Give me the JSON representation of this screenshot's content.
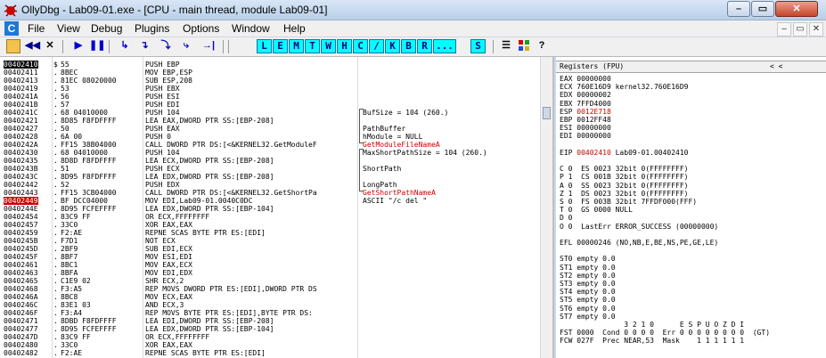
{
  "window": {
    "title": "OllyDbg - Lab09-01.exe - [CPU - main thread, module Lab09-01]",
    "min": "–",
    "max": "▭",
    "close": "✕"
  },
  "menu": {
    "icon": "C",
    "items": [
      "File",
      "View",
      "Debug",
      "Plugins",
      "Options",
      "Window",
      "Help"
    ],
    "mdi": [
      "–",
      "▭",
      "✕"
    ]
  },
  "toolbar": {
    "buttons": [
      {
        "name": "open-icon",
        "glyph": "📂"
      },
      {
        "name": "restart-icon",
        "glyph": "◀◀"
      },
      {
        "name": "close-program-icon",
        "glyph": "✕"
      },
      {
        "name": "run-icon",
        "glyph": "▶"
      },
      {
        "name": "pause-icon",
        "glyph": "❚❚"
      },
      {
        "name": "step-into-icon",
        "glyph": "↳"
      },
      {
        "name": "step-over-icon",
        "glyph": "↴"
      },
      {
        "name": "trace-into-icon",
        "glyph": "⤵"
      },
      {
        "name": "trace-over-icon",
        "glyph": "⤷"
      },
      {
        "name": "execute-till-return-icon",
        "glyph": "→|"
      }
    ],
    "letters": [
      "L",
      "E",
      "M",
      "T",
      "W",
      "H",
      "C",
      "/",
      "K",
      "B",
      "R",
      "...",
      "S"
    ]
  },
  "disasm": [
    {
      "addr": "00402410",
      "mark": "$",
      "hex": "55",
      "ins": "PUSH EBP",
      "cmt": "",
      "state": "sel"
    },
    {
      "addr": "00402411",
      "mark": ".",
      "hex": "8BEC",
      "ins": "MOV EBP,ESP",
      "cmt": ""
    },
    {
      "addr": "00402413",
      "mark": ".",
      "hex": "81EC 08020000",
      "ins": "SUB ESP,208",
      "cmt": ""
    },
    {
      "addr": "00402419",
      "mark": ".",
      "hex": "53",
      "ins": "PUSH EBX",
      "cmt": ""
    },
    {
      "addr": "0040241A",
      "mark": ".",
      "hex": "56",
      "ins": "PUSH ESI",
      "cmt": ""
    },
    {
      "addr": "0040241B",
      "mark": ".",
      "hex": "57",
      "ins": "PUSH EDI",
      "cmt": ""
    },
    {
      "addr": "0040241C",
      "mark": ".",
      "hex": "68 04010000",
      "ins": "PUSH 104",
      "cmt": "BufSize = 104 (260.)"
    },
    {
      "addr": "00402421",
      "mark": ".",
      "hex": "8D85 F8FDFFFF",
      "ins": "LEA EAX,DWORD PTR SS:[EBP-208]",
      "cmt": ""
    },
    {
      "addr": "00402427",
      "mark": ".",
      "hex": "50",
      "ins": "PUSH EAX",
      "cmt": "PathBuffer"
    },
    {
      "addr": "00402428",
      "mark": ".",
      "hex": "6A 00",
      "ins": "PUSH 0",
      "cmt": "hModule = NULL"
    },
    {
      "addr": "0040242A",
      "mark": ".",
      "hex": "FF15 38B04000",
      "ins": "CALL DWORD PTR DS:[<&KERNEL32.GetModuleF",
      "cmt": "GetModuleFileNameA",
      "cmtRed": true
    },
    {
      "addr": "00402430",
      "mark": ".",
      "hex": "68 04010000",
      "ins": "PUSH 104",
      "cmt": "MaxShortPathSize = 104 (260.)"
    },
    {
      "addr": "00402435",
      "mark": ".",
      "hex": "8D8D F8FDFFFF",
      "ins": "LEA ECX,DWORD PTR SS:[EBP-208]",
      "cmt": ""
    },
    {
      "addr": "0040243B",
      "mark": ".",
      "hex": "51",
      "ins": "PUSH ECX",
      "cmt": "ShortPath"
    },
    {
      "addr": "0040243C",
      "mark": ".",
      "hex": "8D95 F8FDFFFF",
      "ins": "LEA EDX,DWORD PTR SS:[EBP-208]",
      "cmt": ""
    },
    {
      "addr": "00402442",
      "mark": ".",
      "hex": "52",
      "ins": "PUSH EDX",
      "cmt": "LongPath"
    },
    {
      "addr": "00402443",
      "mark": ".",
      "hex": "FF15 3CB04000",
      "ins": "CALL DWORD PTR DS:[<&KERNEL32.GetShortPa",
      "cmt": "GetShortPathNameA",
      "cmtRed": true
    },
    {
      "addr": "00402449",
      "mark": ".",
      "hex": "BF DCC04000",
      "ins": "MOV EDI,Lab09-01.0040C0DC",
      "cmt": "ASCII \"/c del \"",
      "state": "bp"
    },
    {
      "addr": "0040244E",
      "mark": ".",
      "hex": "8D95 FCFEFFFF",
      "ins": "LEA EDX,DWORD PTR SS:[EBP-104]",
      "cmt": ""
    },
    {
      "addr": "00402454",
      "mark": ".",
      "hex": "83C9 FF",
      "ins": "OR ECX,FFFFFFFF",
      "cmt": ""
    },
    {
      "addr": "00402457",
      "mark": ".",
      "hex": "33C0",
      "ins": "XOR EAX,EAX",
      "cmt": ""
    },
    {
      "addr": "00402459",
      "mark": ".",
      "hex": "F2:AE",
      "ins": "REPNE SCAS BYTE PTR ES:[EDI]",
      "cmt": ""
    },
    {
      "addr": "0040245B",
      "mark": ".",
      "hex": "F7D1",
      "ins": "NOT ECX",
      "cmt": ""
    },
    {
      "addr": "0040245D",
      "mark": ".",
      "hex": "2BF9",
      "ins": "SUB EDI,ECX",
      "cmt": ""
    },
    {
      "addr": "0040245F",
      "mark": ".",
      "hex": "8BF7",
      "ins": "MOV ESI,EDI",
      "cmt": ""
    },
    {
      "addr": "00402461",
      "mark": ".",
      "hex": "8BC1",
      "ins": "MOV EAX,ECX",
      "cmt": ""
    },
    {
      "addr": "00402463",
      "mark": ".",
      "hex": "8BFA",
      "ins": "MOV EDI,EDX",
      "cmt": ""
    },
    {
      "addr": "00402465",
      "mark": ".",
      "hex": "C1E9 02",
      "ins": "SHR ECX,2",
      "cmt": ""
    },
    {
      "addr": "00402468",
      "mark": ".",
      "hex": "F3:A5",
      "ins": "REP MOVS DWORD PTR ES:[EDI],DWORD PTR DS",
      "cmt": ""
    },
    {
      "addr": "0040246A",
      "mark": ".",
      "hex": "8BC8",
      "ins": "MOV ECX,EAX",
      "cmt": ""
    },
    {
      "addr": "0040246C",
      "mark": ".",
      "hex": "83E1 03",
      "ins": "AND ECX,3",
      "cmt": ""
    },
    {
      "addr": "0040246F",
      "mark": ".",
      "hex": "F3:A4",
      "ins": "REP MOVS BYTE PTR ES:[EDI],BYTE PTR DS:",
      "cmt": ""
    },
    {
      "addr": "00402471",
      "mark": ".",
      "hex": "8DBD F8FDFFFF",
      "ins": "LEA EDI,DWORD PTR SS:[EBP-208]",
      "cmt": ""
    },
    {
      "addr": "00402477",
      "mark": ".",
      "hex": "8D95 FCFEFFFF",
      "ins": "LEA EDX,DWORD PTR SS:[EBP-104]",
      "cmt": ""
    },
    {
      "addr": "0040247D",
      "mark": ".",
      "hex": "83C9 FF",
      "ins": "OR ECX,FFFFFFFF",
      "cmt": ""
    },
    {
      "addr": "00402480",
      "mark": ".",
      "hex": "33C0",
      "ins": "XOR EAX,EAX",
      "cmt": ""
    },
    {
      "addr": "00402482",
      "mark": ".",
      "hex": "F2:AE",
      "ins": "REPNE SCAS BYTE PTR ES:[EDI]",
      "cmt": ""
    }
  ],
  "registers": {
    "header": "Registers (FPU)",
    "header_arrows": "<     <",
    "lines": [
      {
        "t": "EAX 00000000"
      },
      {
        "t": "ECX 760E16D9 kernel32.760E16D9"
      },
      {
        "t": "EDX 00000002"
      },
      {
        "t": "EBX 7FFD4000"
      },
      {
        "t": "ESP 0012E718",
        "redPart": "0012E718"
      },
      {
        "t": "EBP 0012FF48"
      },
      {
        "t": "ESI 00000000"
      },
      {
        "t": "EDI 00000000"
      },
      {
        "t": ""
      },
      {
        "t": "EIP 00402410 Lab09-01.00402410",
        "redPart": "00402410"
      },
      {
        "t": ""
      },
      {
        "t": "C 0  ES 0023 32bit 0(FFFFFFFF)"
      },
      {
        "t": "P 1  CS 001B 32bit 0(FFFFFFFF)"
      },
      {
        "t": "A 0  SS 0023 32bit 0(FFFFFFFF)"
      },
      {
        "t": "Z 1  DS 0023 32bit 0(FFFFFFFF)"
      },
      {
        "t": "S 0  FS 003B 32bit 7FFDF000(FFF)"
      },
      {
        "t": "T 0  GS 0000 NULL"
      },
      {
        "t": "D 0"
      },
      {
        "t": "O 0  LastErr ERROR_SUCCESS (00000000)"
      },
      {
        "t": ""
      },
      {
        "t": "EFL 00000246 (NO,NB,E,BE,NS,PE,GE,LE)"
      },
      {
        "t": ""
      },
      {
        "t": "ST0 empty 0.0"
      },
      {
        "t": "ST1 empty 0.0"
      },
      {
        "t": "ST2 empty 0.0"
      },
      {
        "t": "ST3 empty 0.0"
      },
      {
        "t": "ST4 empty 0.0"
      },
      {
        "t": "ST5 empty 0.0"
      },
      {
        "t": "ST6 empty 0.0"
      },
      {
        "t": "ST7 empty 0.0"
      },
      {
        "t": "               3 2 1 0      E S P U O Z D I"
      },
      {
        "t": "FST 0000  Cond 0 0 0 0  Err 0 0 0 0 0 0 0 0  (GT)"
      },
      {
        "t": "FCW 027F  Prec NEAR,53  Mask    1 1 1 1 1 1"
      }
    ]
  },
  "colors": {
    "accent": "#00ffff",
    "highlight": "#cc0000",
    "selection": "#000000"
  }
}
